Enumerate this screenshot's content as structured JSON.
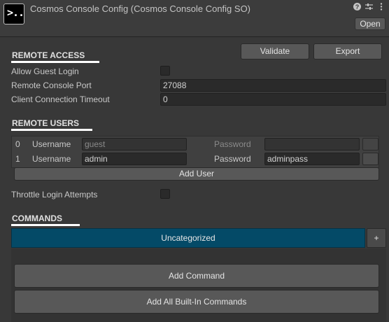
{
  "header": {
    "title": "Cosmos Console Config (Cosmos Console Config SO)",
    "app_icon_text": ">..",
    "icons": [
      "help-icon",
      "sliders-icon",
      "kebab-menu-icon"
    ],
    "open_label": "Open"
  },
  "remote_access": {
    "heading": "REMOTE ACCESS",
    "validate_label": "Validate",
    "export_label": "Export",
    "allow_guest_label": "Allow Guest Login",
    "allow_guest_checked": false,
    "port_label": "Remote Console Port",
    "port_value": "27088",
    "timeout_label": "Client Connection Timeout",
    "timeout_value": "0"
  },
  "remote_users": {
    "heading": "REMOTE USERS",
    "users": [
      {
        "index": "0",
        "username_label": "Username",
        "username": "guest",
        "password_label": "Password",
        "password": "",
        "disabled": true
      },
      {
        "index": "1",
        "username_label": "Username",
        "username": "admin",
        "password_label": "Password",
        "password": "adminpass",
        "disabled": false
      }
    ],
    "add_user_label": "Add User",
    "throttle_label": "Throttle Login Attempts",
    "throttle_checked": false
  },
  "commands": {
    "heading": "COMMANDS",
    "category_tab": "Uncategorized",
    "add_category_label": "+",
    "add_command_label": "Add Command",
    "add_builtin_label": "Add All Built-In Commands"
  },
  "colors": {
    "background": "#383838",
    "category_tab": "#044a67",
    "field": "#2a2a2a"
  }
}
